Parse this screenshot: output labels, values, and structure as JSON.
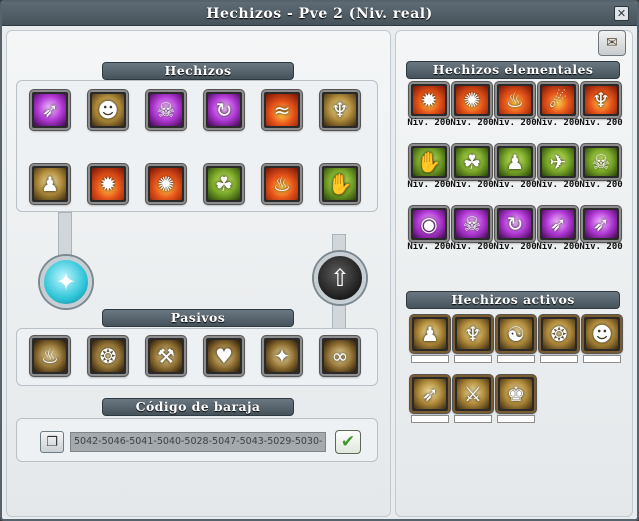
{
  "window": {
    "title": "Hechizos - Pve 2 (Niv. real)",
    "close_glyph": "✕"
  },
  "spells_section": {
    "banner": "Hechizos",
    "spells": [
      {
        "name": "wind-dash-icon",
        "element": "void",
        "glyph": "➶"
      },
      {
        "name": "earth-golem-icon",
        "element": "earth",
        "glyph": "☻"
      },
      {
        "name": "void-mask-icon",
        "element": "void",
        "glyph": "☠"
      },
      {
        "name": "void-swirl-icon",
        "element": "void",
        "glyph": "↻"
      },
      {
        "name": "fire-wave-icon",
        "element": "fire",
        "glyph": "≈"
      },
      {
        "name": "earth-wings-icon",
        "element": "earth",
        "glyph": "♆"
      },
      {
        "name": "earth-figure-icon",
        "element": "earth",
        "glyph": "♟"
      },
      {
        "name": "fire-burst-icon",
        "element": "fire",
        "glyph": "✹"
      },
      {
        "name": "fire-hands-icon",
        "element": "fire",
        "glyph": "✺"
      },
      {
        "name": "nature-jump-icon",
        "element": "nature",
        "glyph": "☘"
      },
      {
        "name": "fire-pillar-icon",
        "element": "fire",
        "glyph": "♨"
      },
      {
        "name": "nature-claw-icon",
        "element": "nature",
        "glyph": "✋"
      }
    ]
  },
  "passives_section": {
    "banner": "Pasivos",
    "passives": [
      {
        "name": "flame-aura-passive-icon",
        "glyph": "♨"
      },
      {
        "name": "spiral-passive-icon",
        "glyph": "❂"
      },
      {
        "name": "hammer-passive-icon",
        "glyph": "⚒"
      },
      {
        "name": "heart-hand-passive-icon",
        "glyph": "♥"
      },
      {
        "name": "blood-rune-passive-icon",
        "glyph": "✦"
      },
      {
        "name": "infinity-heart-passive-icon",
        "glyph": "∞"
      }
    ]
  },
  "deck_section": {
    "banner": "Código de baraja",
    "code": "5042-5046-5041-5040-5028-5047-5043-5029-5030-",
    "copy_glyph": "❐",
    "confirm_glyph": "✔"
  },
  "knobs": {
    "left_glyph": "✦",
    "right_glyph": "⇧"
  },
  "elemental_section": {
    "banner": "Hechizos elementales",
    "rows": [
      [
        {
          "element": "fire",
          "glyph": "✹",
          "level": "Niv. 200"
        },
        {
          "element": "fire",
          "glyph": "✺",
          "level": "Niv. 200"
        },
        {
          "element": "fire",
          "glyph": "♨",
          "level": "Niv. 200"
        },
        {
          "element": "fire",
          "glyph": "☄",
          "level": "Niv. 200"
        },
        {
          "element": "fire",
          "glyph": "♆",
          "level": "Niv. 200"
        }
      ],
      [
        {
          "element": "nature",
          "glyph": "✋",
          "level": "Niv. 200"
        },
        {
          "element": "nature",
          "glyph": "☘",
          "level": "Niv. 200"
        },
        {
          "element": "nature",
          "glyph": "♟",
          "level": "Niv. 200"
        },
        {
          "element": "nature",
          "glyph": "✈",
          "level": "Niv. 200"
        },
        {
          "element": "nature",
          "glyph": "☠",
          "level": "Niv. 200"
        }
      ],
      [
        {
          "element": "void",
          "glyph": "◉",
          "level": "Niv. 200"
        },
        {
          "element": "void",
          "glyph": "☠",
          "level": "Niv. 200"
        },
        {
          "element": "void",
          "glyph": "↻",
          "level": "Niv. 200"
        },
        {
          "element": "void",
          "glyph": "➶",
          "level": "Niv. 200"
        },
        {
          "element": "void",
          "glyph": "➶",
          "level": "Niv. 200"
        }
      ]
    ]
  },
  "active_section": {
    "banner": "Hechizos activos",
    "spells": [
      {
        "glyph": "♟"
      },
      {
        "glyph": "♆"
      },
      {
        "glyph": "☯"
      },
      {
        "glyph": "❂"
      },
      {
        "glyph": "☻"
      },
      {
        "glyph": "➶"
      },
      {
        "glyph": "⚔"
      },
      {
        "glyph": "♚"
      }
    ]
  },
  "scroll_glyph": "✉"
}
